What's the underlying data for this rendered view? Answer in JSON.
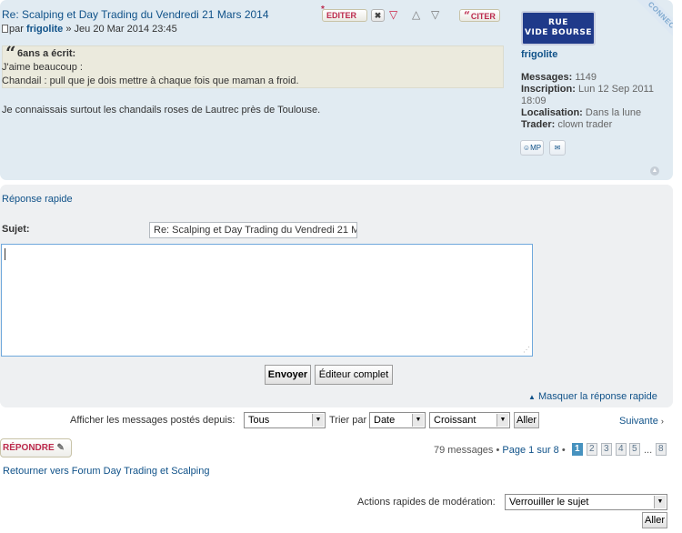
{
  "post": {
    "title": "Re: Scalping et Day Trading du Vendredi 21 Mars 2014",
    "by_prefix": "par",
    "author": "frigolite",
    "date": "» Jeu 20 Mar 2014 23:45",
    "edit_label": "EDITER",
    "quote_label": "CITER",
    "quote": {
      "cite": "6ans a écrit:",
      "line1": "J'aime beaucoup :",
      "line2": "Chandail : pull que je dois mettre à chaque fois que maman a froid."
    },
    "body": "Je connaissais surtout les chandails roses de Lautrec près de Toulouse."
  },
  "profile": {
    "ribbon": "CONNECTÉ",
    "avatar_line1": "RUE",
    "avatar_line2": "VIDE BOURSE",
    "username": "frigolite",
    "messages_label": "Messages:",
    "messages_value": "1149",
    "inscription_label": "Inscription:",
    "inscription_value": "Lun 12 Sep 2011",
    "inscription_time": "18:09",
    "localisation_label": "Localisation:",
    "localisation_value": "Dans la lune",
    "trader_label": "Trader:",
    "trader_value": "clown trader",
    "pm_label": "MP"
  },
  "quick_reply": {
    "title": "Réponse rapide",
    "subject_label": "Sujet:",
    "subject_value": "Re: Scalping et Day Trading du Vendredi 21 M",
    "send_label": "Envoyer",
    "full_editor_label": "Éditeur complet",
    "hide_label": "Masquer la réponse rapide"
  },
  "filters": {
    "display_label": "Afficher les messages postés depuis:",
    "days_value": "Tous",
    "sort_label": "Trier par",
    "sort_value": "Date",
    "order_value": "Croissant",
    "go_label": "Aller",
    "next_label": "Suivante"
  },
  "pagination": {
    "reply_label": "RÉPONDRE",
    "summary": "79 messages •",
    "page_text": "Page 1 sur 8",
    "bullet": "•",
    "pages": [
      "1",
      "2",
      "3",
      "4",
      "5"
    ],
    "ellipsis": "...",
    "last_page": "8"
  },
  "return_link": "Retourner vers Forum Day Trading et Scalping",
  "moderation": {
    "label": "Actions rapides de modération:",
    "value": "Verrouiller le sujet",
    "go_label": "Aller"
  },
  "colors": {
    "post_bg": "#e1ebf2",
    "reply_bg": "#eef0f2",
    "link": "#105289",
    "button_red": "#bc2a4d",
    "active_page": "#4692bf"
  }
}
